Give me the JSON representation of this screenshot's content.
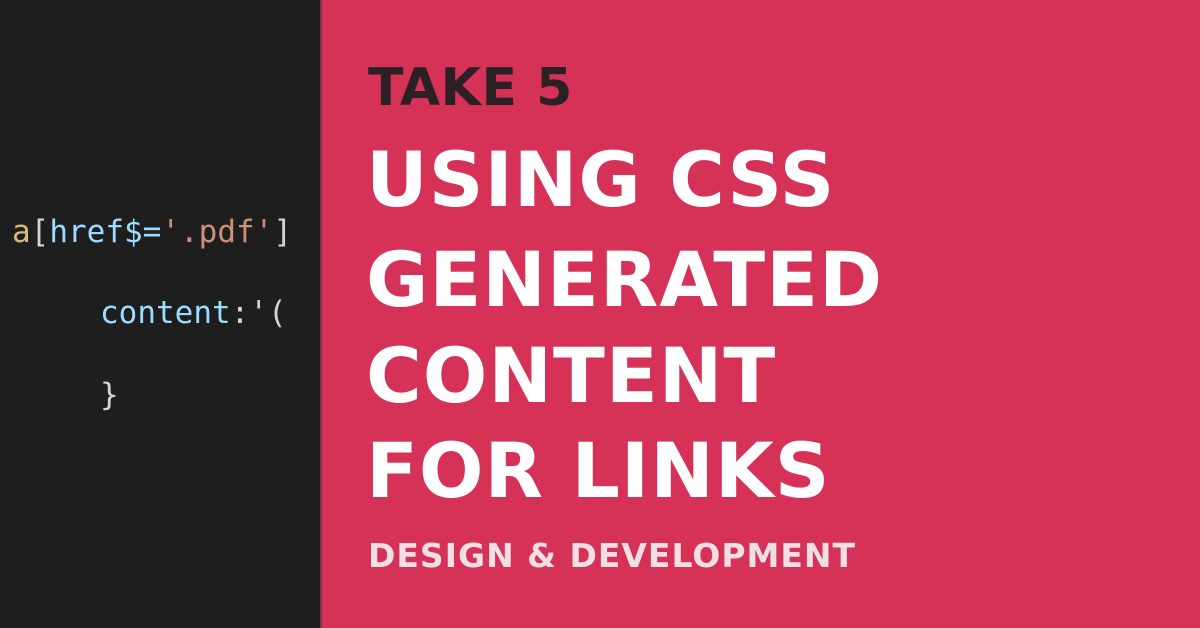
{
  "code": {
    "line1": {
      "selector": "a",
      "open_bracket": "[",
      "attr": "href$=",
      "value": "'.pdf'",
      "close_bracket": "]"
    },
    "line2": {
      "property": "content",
      "colon": ":",
      "value": "'("
    },
    "line3": {
      "brace": "}"
    }
  },
  "banner": {
    "eyebrow": "TAKE 5",
    "title_lines": [
      "USING CSS",
      "GENERATED",
      "CONTENT",
      "FOR LINKS"
    ],
    "category": "DESIGN & DEVELOPMENT"
  },
  "colors": {
    "accent": "#d63157",
    "code_background": "#1e1e1e",
    "eyebrow_text": "#2b2124",
    "title_text": "#ffffff",
    "category_text": "#f0dfe3"
  }
}
